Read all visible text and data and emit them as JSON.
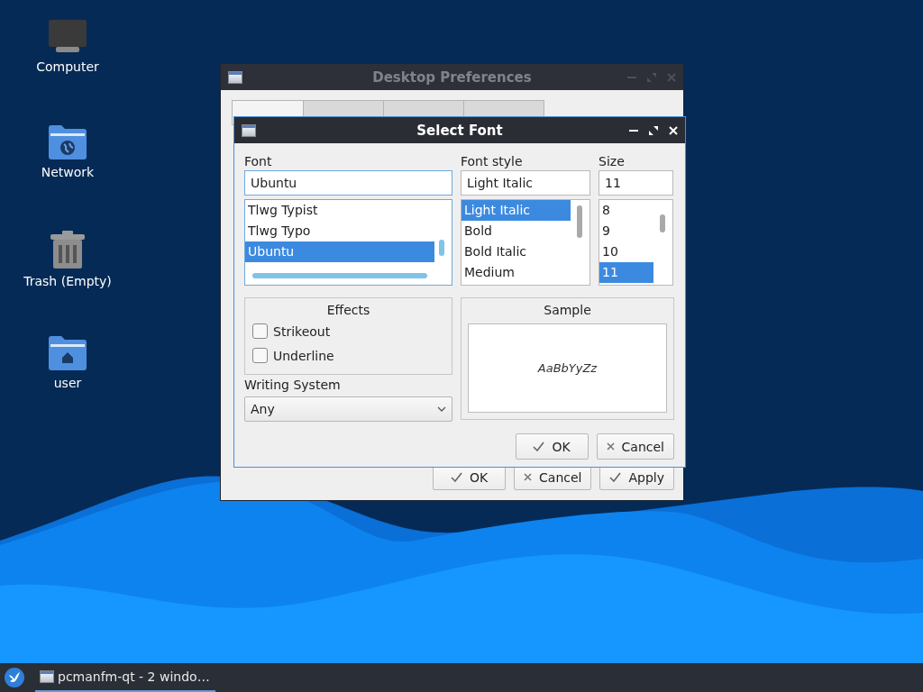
{
  "desktop_icons": [
    {
      "label": "Computer",
      "kind": "computer"
    },
    {
      "label": "Network",
      "kind": "network"
    },
    {
      "label": "Trash (Empty)",
      "kind": "trash"
    },
    {
      "label": "user",
      "kind": "home"
    }
  ],
  "back_window": {
    "title": "Desktop Preferences",
    "tabs": [
      {
        "selected": true
      },
      {
        "selected": false
      },
      {
        "selected": false
      },
      {
        "selected": false
      }
    ],
    "buttons": [
      {
        "label": "OK",
        "kind": "ok"
      },
      {
        "label": "Cancel",
        "kind": "cancel"
      },
      {
        "label": "Apply",
        "kind": "ok"
      }
    ]
  },
  "dialog": {
    "title": "Select Font",
    "font": {
      "label": "Font",
      "value": "Ubuntu",
      "items": [
        {
          "label": "Tlwg Typist",
          "selected": false
        },
        {
          "label": "Tlwg Typo",
          "selected": false
        },
        {
          "label": "Ubuntu",
          "selected": true
        }
      ]
    },
    "style": {
      "label": "Font style",
      "value": "Light Italic",
      "items": [
        {
          "label": "Light Italic",
          "selected": true
        },
        {
          "label": "Bold",
          "selected": false
        },
        {
          "label": "Bold Italic",
          "selected": false
        },
        {
          "label": "Medium",
          "selected": false
        }
      ]
    },
    "size": {
      "label": "Size",
      "value": "11",
      "items": [
        {
          "label": "8",
          "selected": false
        },
        {
          "label": "9",
          "selected": false
        },
        {
          "label": "10",
          "selected": false
        },
        {
          "label": "11",
          "selected": true
        }
      ]
    },
    "effects": {
      "title": "Effects",
      "options": [
        {
          "label": "Strikeout",
          "checked": false
        },
        {
          "label": "Underline",
          "checked": false
        }
      ]
    },
    "writing_system": {
      "label": "Writing System",
      "value": "Any"
    },
    "sample": {
      "title": "Sample",
      "text": "AaBbYyZz"
    },
    "buttons": [
      {
        "label": "OK",
        "kind": "ok"
      },
      {
        "label": "Cancel",
        "kind": "cancel"
      }
    ]
  },
  "taskbar": {
    "task": {
      "label": "pcmanfm-qt - 2 windo…",
      "active": true
    }
  }
}
